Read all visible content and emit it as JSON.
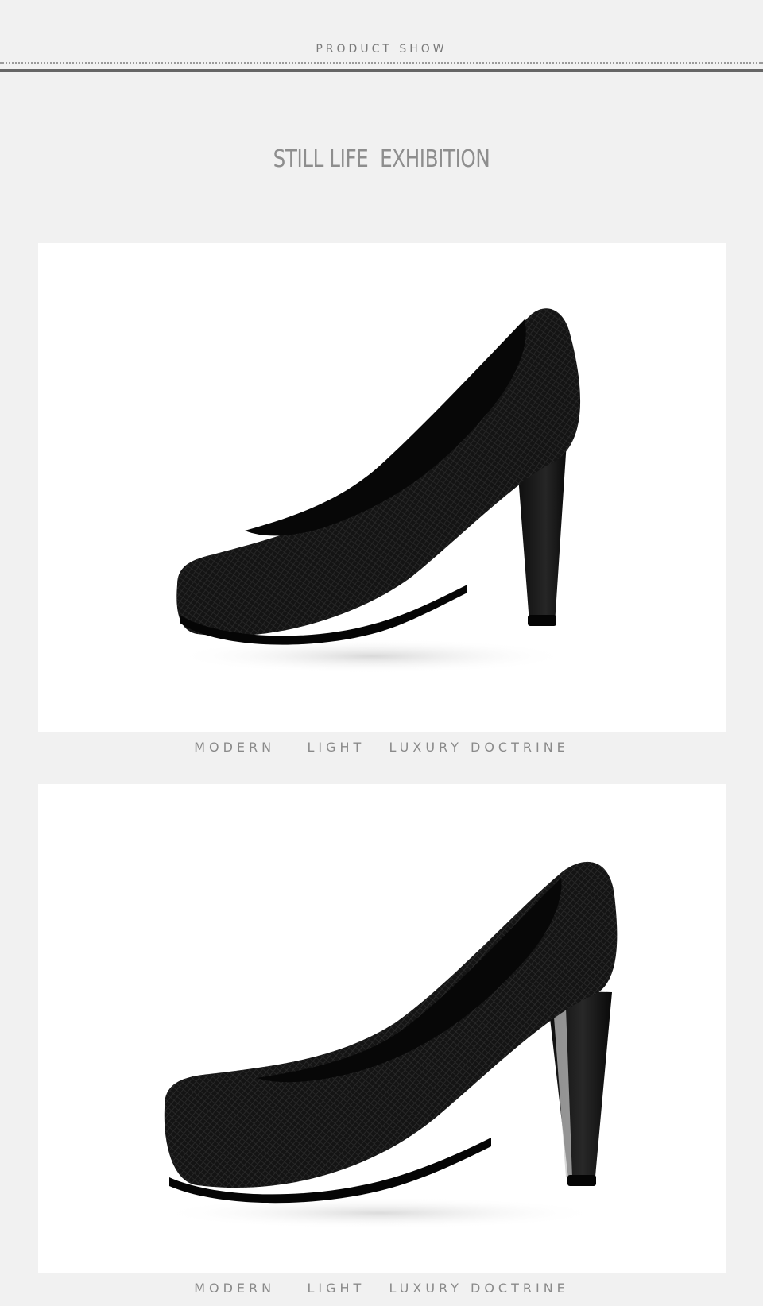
{
  "header": {
    "section_label": "PRODUCT SHOW",
    "headline": "STILL LIFE  EXHIBITION"
  },
  "gallery": [
    {
      "caption": "MODERN    LIGHT   LUXURY DOCTRINE",
      "image": "black-platform-pump-shoe",
      "view": "three-quarter front"
    },
    {
      "caption": "MODERN    LIGHT   LUXURY DOCTRINE",
      "image": "black-platform-pump-shoe",
      "view": "side profile"
    }
  ],
  "colors": {
    "page_background": "#f1f1f1",
    "panel_background": "#ffffff",
    "text_gray": "#8a8a8a",
    "shoe_black": "#121212"
  }
}
